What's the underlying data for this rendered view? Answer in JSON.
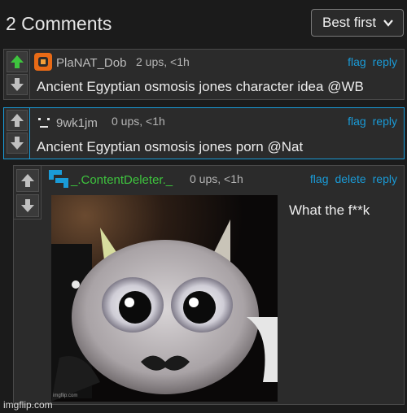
{
  "header": {
    "comment_count_label": "2 Comments",
    "sort": {
      "selected": "Best first"
    }
  },
  "comments": [
    {
      "username": "PlaNAT_Dob",
      "meta": "2 ups, <1h",
      "actions": [
        "flag",
        "reply"
      ],
      "text": "Ancient Egyptian osmosis jones character idea @WB",
      "upvoted": true,
      "avatar_icon": "orange-pixel-avatar"
    },
    {
      "username": "9wk1jm",
      "meta": "0 ups, <1h",
      "actions": [
        "flag",
        "reply"
      ],
      "text": "Ancient Egyptian osmosis jones porn @Nat",
      "upvoted": false,
      "avatar_icon": "face-emoticon-avatar"
    },
    {
      "username": "_.ContentDeleter._",
      "meta": "0 ups, <1h",
      "actions": [
        "flag",
        "delete",
        "reply"
      ],
      "text": "What the f**k",
      "upvoted": false,
      "avatar_icon": "blue-pixel-avatar",
      "image_watermark": "imgflip.com"
    }
  ],
  "watermark": "imgflip.com",
  "colors": {
    "background": "#1b1b1b",
    "panel": "#2b2b2b",
    "link": "#1a9bd7",
    "upvote_active": "#3ec43e",
    "reply_thread_bar": "#f08a1d",
    "username_green": "#3ec43e",
    "selected_border": "#1a9bd7"
  }
}
